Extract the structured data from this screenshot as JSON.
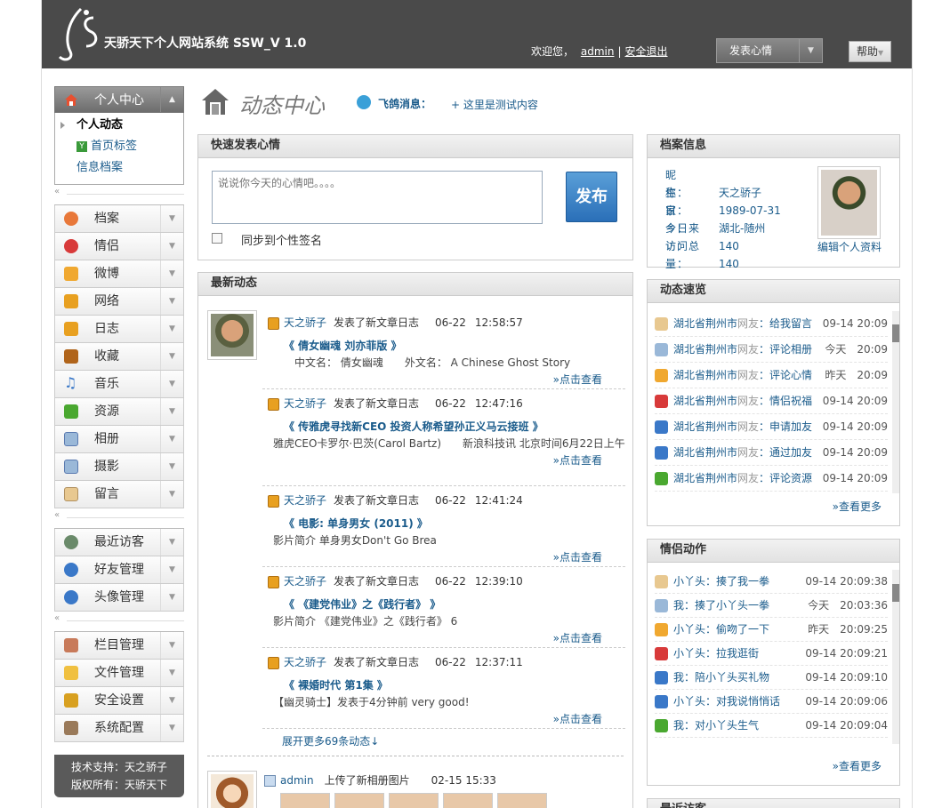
{
  "header": {
    "title": "天骄天下个人网站系统 SSW_V 1.0",
    "welcome": "欢迎您，",
    "user": "admin",
    "logout": "安全退出",
    "post_mood": "发表心情",
    "help": "帮助"
  },
  "sidebar": {
    "center_title": "个人中心",
    "center_items": [
      "个人动态",
      "首页标签",
      "信息档案"
    ],
    "group1": [
      "档案",
      "情侣",
      "微博",
      "网络",
      "日志",
      "收藏",
      "音乐",
      "资源",
      "相册",
      "摄影",
      "留言"
    ],
    "group2": [
      "最近访客",
      "好友管理",
      "头像管理"
    ],
    "group3": [
      "栏目管理",
      "文件管理",
      "安全设置",
      "系统配置"
    ],
    "footer_support": "技术支持：天之骄子",
    "footer_copyright": "版权所有：天骄天下"
  },
  "page": {
    "title": "动态中心",
    "feige_label": "飞鸽消息：",
    "feige_message": "+ 这里是测试内容"
  },
  "quick_post": {
    "title": "快速发表心情",
    "placeholder": "说说你今天的心情吧。。。。",
    "publish": "发布",
    "sync_label": "同步到个性签名"
  },
  "feed": {
    "title": "最新动态",
    "items": [
      {
        "author": "天之骄子",
        "action": "发表了新文章日志",
        "date": "06-22",
        "time": "12:58:57",
        "title": "《 倩女幽魂 刘亦菲版 》",
        "summary": "中文名： 倩女幽魂　　外文名： A Chinese Ghost Story",
        "more": "»点击查看"
      },
      {
        "author": "天之骄子",
        "action": "发表了新文章日志",
        "date": "06-22",
        "time": "12:47:16",
        "title": "《 传雅虎寻找新CEO 投资人称希望孙正义马云接班 》",
        "summary": "雅虎CEO卡罗尔·巴茨(Carol Bartz)　　新浪科技讯 北京时间6月22日上午",
        "more": "»点击查看"
      },
      {
        "author": "天之骄子",
        "action": "发表了新文章日志",
        "date": "06-22",
        "time": "12:41:24",
        "title": "《 电影: 单身男女 (2011) 》",
        "summary": "影片简介 单身男女Don't Go Brea",
        "more": "»点击查看"
      },
      {
        "author": "天之骄子",
        "action": "发表了新文章日志",
        "date": "06-22",
        "time": "12:39:10",
        "title": "《 《建党伟业》之《践行者》 》",
        "summary": "影片简介 《建党伟业》之《践行者》 6",
        "more": "»点击查看"
      },
      {
        "author": "天之骄子",
        "action": "发表了新文章日志",
        "date": "06-22",
        "time": "12:37:11",
        "title": "《 裸婚时代 第1集 》",
        "summary": "【幽灵骑士】发表于4分钟前 very good!",
        "more": "»点击查看"
      }
    ],
    "expand": "展开更多69条动态↓",
    "admin_author": "admin",
    "admin_action": "上传了新相册图片",
    "admin_time": "02-15 15:33"
  },
  "profile": {
    "title": "档案信息",
    "rows": [
      {
        "k": "昵　　称：",
        "v": "天之骄子"
      },
      {
        "k": "生　　日：",
        "v": "1989-07-31"
      },
      {
        "k": "家　　乡：",
        "v": "湖北-随州"
      },
      {
        "k": "今日来访：",
        "v": "140"
      },
      {
        "k": "访问总量：",
        "v": "140"
      }
    ],
    "edit": "编辑个人资料"
  },
  "activity": {
    "title": "动态速览",
    "rows": [
      {
        "icon": "pencil-icon",
        "color": "#e8c890",
        "u": "湖北省荆州市",
        "g": "网友",
        "w": "：给我留言",
        "t": "09-14 20:09"
      },
      {
        "icon": "photo-icon",
        "color": "#9ab8d8",
        "u": "湖北省荆州市",
        "g": "网友",
        "w": "：评论相册",
        "t": "今天　20:09"
      },
      {
        "icon": "star-icon",
        "color": "#f0a830",
        "u": "湖北省荆州市",
        "g": "网友",
        "w": "：评论心情",
        "t": "昨天　20:09"
      },
      {
        "icon": "heart-icon",
        "color": "#d83a3a",
        "u": "湖北省荆州市",
        "g": "网友",
        "w": "：情侣祝福",
        "t": "09-14 20:09"
      },
      {
        "icon": "user-icon",
        "color": "#3a78c8",
        "u": "湖北省荆州市",
        "g": "网友",
        "w": "：申请加友",
        "t": "09-14 20:09"
      },
      {
        "icon": "user-icon",
        "color": "#3a78c8",
        "u": "湖北省荆州市",
        "g": "网友",
        "w": "：通过加友",
        "t": "09-14 20:09"
      },
      {
        "icon": "download-icon",
        "color": "#4aa830",
        "u": "湖北省荆州市",
        "g": "网友",
        "w": "：评论资源",
        "t": "09-14 20:09"
      }
    ],
    "more": "»查看更多"
  },
  "couple": {
    "title": "情侣动作",
    "rows": [
      {
        "icon": "pencil-icon",
        "color": "#e8c890",
        "w": "小丫头：揍了我一拳",
        "t": "09-14 20:09:38"
      },
      {
        "icon": "photo-icon",
        "color": "#9ab8d8",
        "w": "我：揍了小丫头一拳",
        "t": "今天　20:03:36"
      },
      {
        "icon": "star-icon",
        "color": "#f0a830",
        "w": "小丫头：偷吻了一下",
        "t": "昨天　20:09:25"
      },
      {
        "icon": "heart-icon",
        "color": "#d83a3a",
        "w": "小丫头：拉我逛街",
        "t": "09-14 20:09:21"
      },
      {
        "icon": "user-icon",
        "color": "#3a78c8",
        "w": "我：陪小丫头买礼物",
        "t": "09-14 20:09:10"
      },
      {
        "icon": "user-icon",
        "color": "#3a78c8",
        "w": "小丫头：对我说悄悄话",
        "t": "09-14 20:09:06"
      },
      {
        "icon": "download-icon",
        "color": "#4aa830",
        "w": "我：对小丫头生气",
        "t": "09-14 20:09:04"
      }
    ],
    "more": "»查看更多"
  },
  "visitors": {
    "title": "最近访客"
  }
}
